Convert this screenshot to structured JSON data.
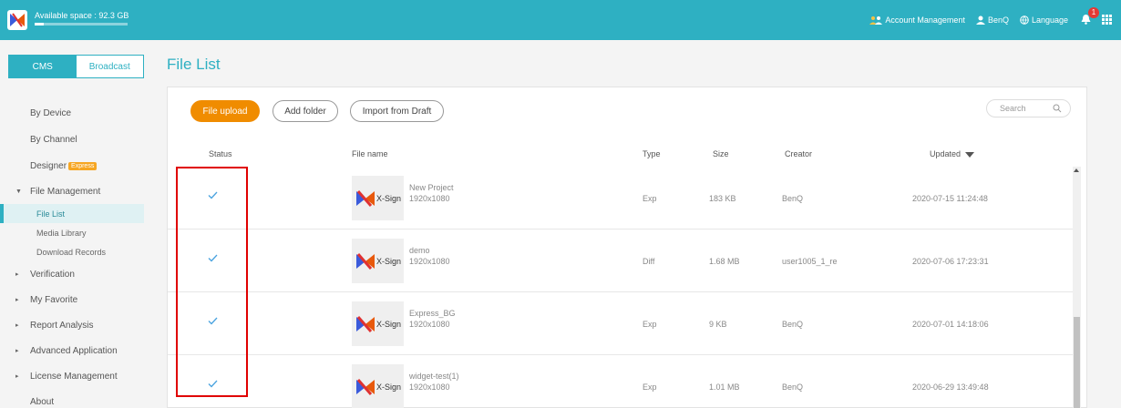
{
  "header": {
    "available_space": "Available space : 92.3 GB",
    "space_used_fraction": 0.1,
    "account_management": "Account Management",
    "user": "BenQ",
    "language": "Language",
    "notification_count": "1"
  },
  "sidebar": {
    "tab_cms": "CMS",
    "tab_broadcast": "Broadcast",
    "by_device": "By Device",
    "by_channel": "By Channel",
    "designer": "Designer",
    "designer_badge": "Express",
    "file_management": "File Management",
    "file_list": "File List",
    "media_library": "Media Library",
    "download_records": "Download Records",
    "verification": "Verification",
    "my_favorite": "My Favorite",
    "report_analysis": "Report Analysis",
    "advanced_application": "Advanced Application",
    "license_management": "License Management",
    "about": "About"
  },
  "main": {
    "title": "File List",
    "file_upload": "File upload",
    "add_folder": "Add folder",
    "import_from_draft": "Import from Draft",
    "search_placeholder": "Search",
    "columns": {
      "status": "Status",
      "file_name": "File name",
      "type": "Type",
      "size": "Size",
      "creator": "Creator",
      "updated": "Updated"
    },
    "thumb_label": "X-Sign",
    "rows": [
      {
        "name": "New Project",
        "resolution": "1920x1080",
        "type": "Exp",
        "size": "183 KB",
        "creator": "BenQ",
        "updated": "2020-07-15 11:24:48"
      },
      {
        "name": "demo",
        "resolution": "1920x1080",
        "type": "Diff",
        "size": "1.68 MB",
        "creator": "user1005_1_re",
        "updated": "2020-07-06 17:23:31"
      },
      {
        "name": "Express_BG",
        "resolution": "1920x1080",
        "type": "Exp",
        "size": "9 KB",
        "creator": "BenQ",
        "updated": "2020-07-01 14:18:06"
      },
      {
        "name": "widget-test(1)",
        "resolution": "1920x1080",
        "type": "Exp",
        "size": "1.01 MB",
        "creator": "BenQ",
        "updated": "2020-06-29 13:49:48"
      }
    ]
  },
  "colors": {
    "accent": "#2eb0c2",
    "primary_button": "#f08c00",
    "badge": "#f6a623",
    "highlight": "#e00000"
  }
}
